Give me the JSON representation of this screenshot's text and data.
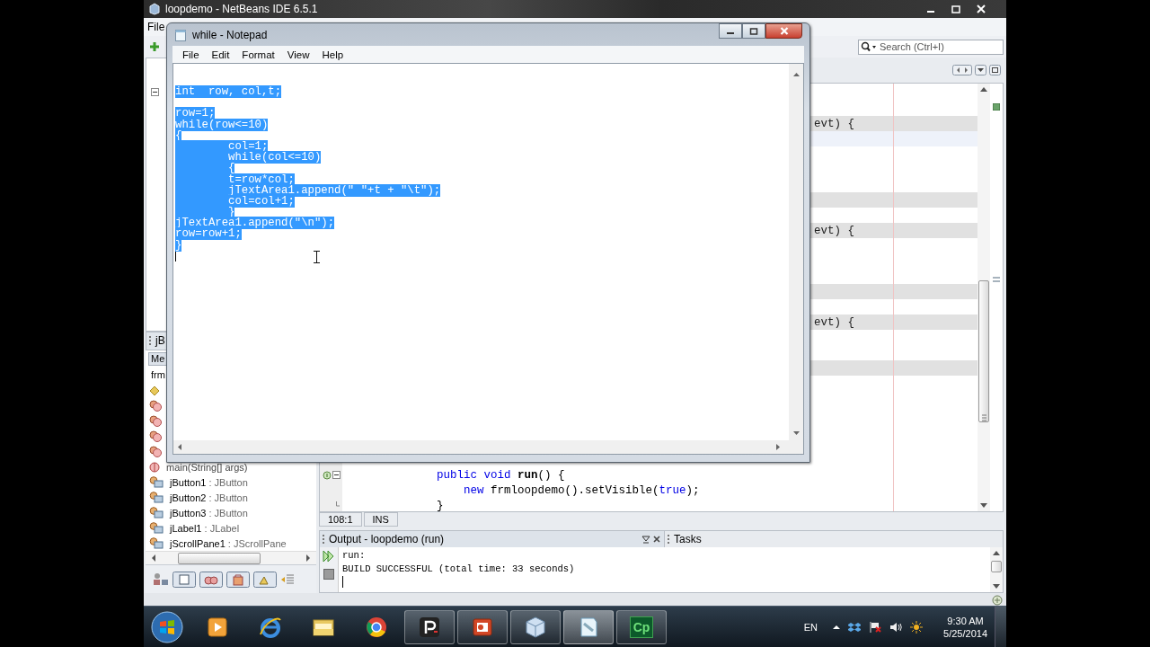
{
  "ide": {
    "title": "loopdemo - NetBeans IDE 6.5.1",
    "menu": [
      "File"
    ],
    "search": {
      "placeholder": "Search (Ctrl+I)"
    },
    "navigator": {
      "header": "jB",
      "filter": "Me",
      "root": "frm",
      "members": [
        {
          "kind": "diamond"
        },
        {
          "kind": "field"
        },
        {
          "kind": "field"
        },
        {
          "kind": "field"
        },
        {
          "kind": "field"
        },
        {
          "kind": "method",
          "name": "main(String[] args)"
        },
        {
          "kind": "component",
          "name": "jButton1",
          "type": ": JButton"
        },
        {
          "kind": "component",
          "name": "jButton2",
          "type": ": JButton"
        },
        {
          "kind": "component",
          "name": "jButton3",
          "type": ": JButton"
        },
        {
          "kind": "component",
          "name": "jLabel1",
          "type": ": JLabel"
        },
        {
          "kind": "component",
          "name": "jScrollPane1",
          "type": ": JScrollPane"
        }
      ]
    },
    "editor": {
      "lines": [
        {
          "kind": "highlight",
          "text": "evt) {"
        },
        {
          "kind": "current"
        },
        {
          "kind": "plain"
        },
        {
          "kind": "plain"
        },
        {
          "kind": "plain"
        },
        {
          "kind": "highlight"
        },
        {
          "kind": "plain"
        },
        {
          "kind": "highlight",
          "text": "evt) {"
        },
        {
          "kind": "plain"
        },
        {
          "kind": "plain"
        },
        {
          "kind": "plain"
        },
        {
          "kind": "highlight"
        },
        {
          "kind": "plain"
        },
        {
          "kind": "highlight",
          "text": "evt) {"
        },
        {
          "kind": "plain"
        },
        {
          "kind": "plain"
        },
        {
          "kind": "highlight"
        },
        {
          "kind": "plain"
        },
        {
          "kind": "plain"
        },
        {
          "kind": "plain"
        },
        {
          "kind": "plain"
        },
        {
          "kind": "plain"
        },
        {
          "kind": "plain"
        },
        {
          "kind": "fold-start",
          "segments": [
            {
              "text": "              public void ",
              "kind": "keyword"
            },
            {
              "text": "run",
              "kind": "method"
            },
            {
              "text": "() {",
              "kind": "plain"
            }
          ]
        },
        {
          "kind": "code",
          "segments": [
            {
              "text": "                  new",
              "kind": "keyword"
            },
            {
              "text": " frmloopdemo().setVisible(",
              "kind": "plain"
            },
            {
              "text": "true",
              "kind": "keyword"
            },
            {
              "text": ");",
              "kind": "plain"
            }
          ]
        },
        {
          "kind": "fold-end",
          "segments": [
            {
              "text": "              }",
              "kind": "plain"
            }
          ]
        }
      ]
    },
    "status": {
      "position": "108:1",
      "mode": "INS"
    },
    "output": {
      "tabs": [
        {
          "label": "Output - loopdemo (run)",
          "selected": true
        },
        {
          "label": "Tasks",
          "selected": false
        }
      ],
      "lines": [
        "run:",
        "BUILD SUCCESSFUL (total time: 33 seconds)"
      ]
    }
  },
  "notepad": {
    "title": "while - Notepad",
    "menu": [
      "File",
      "Edit",
      "Format",
      "View",
      "Help"
    ],
    "blocks": [
      {
        "lines": [
          {
            "text": "int  row, col,t;",
            "selected": true
          }
        ]
      },
      {
        "lines": [
          {
            "text": "row=1;",
            "selected": true
          },
          {
            "text": "while(row<=10)",
            "selected": true
          },
          {
            "text": "{",
            "selected": true
          },
          {
            "text": "\tcol=1;",
            "selected": true
          },
          {
            "text": "\twhile(col<=10)",
            "selected": true
          },
          {
            "text": "\t{",
            "selected": true
          },
          {
            "text": "\tt=row*col;",
            "selected": true
          },
          {
            "text": "\tjTextArea1.append(\" \"+t + \"\\t\");",
            "selected": true
          },
          {
            "text": "\tcol=col+1;",
            "selected": true
          },
          {
            "text": "\t}",
            "selected": true
          },
          {
            "text": "jTextArea1.append(\"\\n\");",
            "selected": true
          },
          {
            "text": "row=row+1;",
            "selected": true
          },
          {
            "text": "}",
            "selected": true
          }
        ]
      }
    ]
  },
  "taskbar": {
    "apps": [
      {
        "kind": "media",
        "open": false,
        "selected": false
      },
      {
        "kind": "browser",
        "open": false,
        "selected": false
      },
      {
        "kind": "folder",
        "open": false,
        "selected": false
      },
      {
        "kind": "ball",
        "open": false,
        "selected": false
      },
      {
        "kind": "p-logo",
        "open": true,
        "selected": false
      },
      {
        "kind": "slides",
        "open": true,
        "selected": false
      },
      {
        "kind": "cube",
        "open": true,
        "selected": false
      },
      {
        "kind": "notepad",
        "open": true,
        "selected": true
      },
      {
        "kind": "text-logo",
        "label": "Cp",
        "open": true,
        "selected": false
      }
    ],
    "language": "EN",
    "time": "9:30 AM",
    "date": "5/25/2014"
  }
}
